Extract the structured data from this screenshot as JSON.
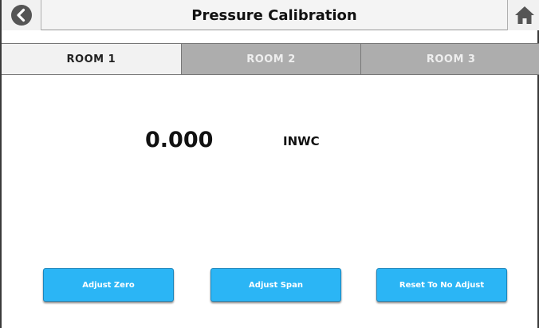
{
  "header": {
    "title": "Pressure Calibration",
    "back_icon": "chevron-left-circle-icon",
    "home_icon": "home-icon"
  },
  "tabs": [
    {
      "label": "ROOM 1",
      "active": true
    },
    {
      "label": "ROOM 2",
      "active": false
    },
    {
      "label": "ROOM 3",
      "active": false
    }
  ],
  "reading": {
    "value": "0.000",
    "unit": "INWC"
  },
  "actions": {
    "adjust_zero": "Adjust Zero",
    "adjust_span": "Adjust Span",
    "reset": "Reset To No Adjust"
  },
  "colors": {
    "button": "#2bb5f5",
    "tab_active": "#f2f2f2",
    "tab_inactive": "#adadad",
    "header": "#f4f4f4"
  }
}
